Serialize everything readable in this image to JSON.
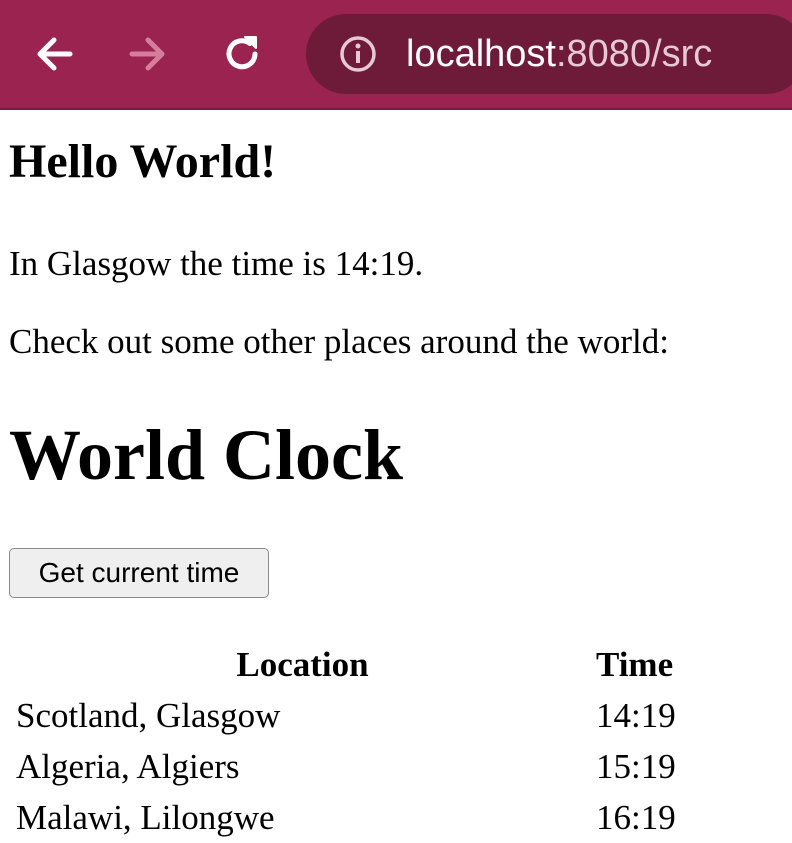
{
  "browser": {
    "url_host": "localhost",
    "url_rest": ":8080/src",
    "accent_color": "#9b2350"
  },
  "page": {
    "heading": "Hello World!",
    "local_time_text": "In Glasgow the time is 14:19.",
    "prompt_text": "Check out some other places around the world:",
    "clock_heading": "World Clock",
    "button_label": "Get current time"
  },
  "table": {
    "headers": [
      "Location",
      "Time"
    ],
    "rows": [
      {
        "location": "Scotland, Glasgow",
        "time": "14:19"
      },
      {
        "location": "Algeria, Algiers",
        "time": "15:19"
      },
      {
        "location": "Malawi, Lilongwe",
        "time": "16:19"
      }
    ]
  },
  "icons": [
    "back-arrow-icon",
    "forward-arrow-icon",
    "reload-icon",
    "info-icon"
  ]
}
